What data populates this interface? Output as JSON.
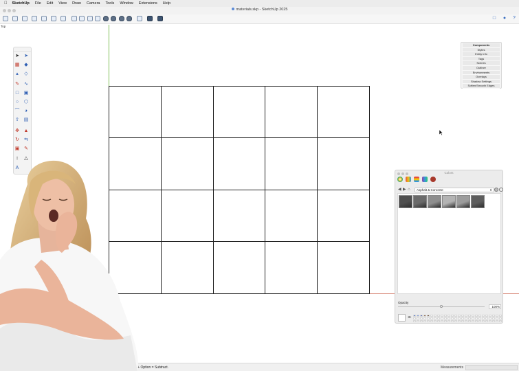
{
  "menubar": {
    "app_name": "SketchUp",
    "items": [
      "File",
      "Edit",
      "View",
      "Draw",
      "Camera",
      "Tools",
      "Window",
      "Extensions",
      "Help"
    ]
  },
  "window": {
    "title": "materials.skp - SketchUp 2025"
  },
  "view_label": "Top",
  "tray": {
    "items": [
      "Components",
      "Styles",
      "Entity Info",
      "Tags",
      "Scenes",
      "Outliner",
      "Environments",
      "Overlays",
      "Shadow Settings",
      "Soften/Smooth Edges"
    ]
  },
  "colors_panel": {
    "title": "Colors",
    "collection": "Asphalt & Concrete",
    "swatch_colors": [
      "#4f4f4f",
      "#6a6a6a",
      "#8e8e8e",
      "#b3b3b3",
      "#9c9c9c",
      "#5e5e5e"
    ],
    "opacity_label": "Opacity",
    "opacity_value": "100%",
    "opacity_level": 0.5,
    "mini_colors": [
      "#5b7fd0",
      "#7f9ee0",
      "#5e6fb8",
      "#8d6a4d",
      "#6b4c33"
    ]
  },
  "status": {
    "hint": "Option = Add. Shift + Option = Subtract.",
    "measurements_label": "Measurements"
  }
}
